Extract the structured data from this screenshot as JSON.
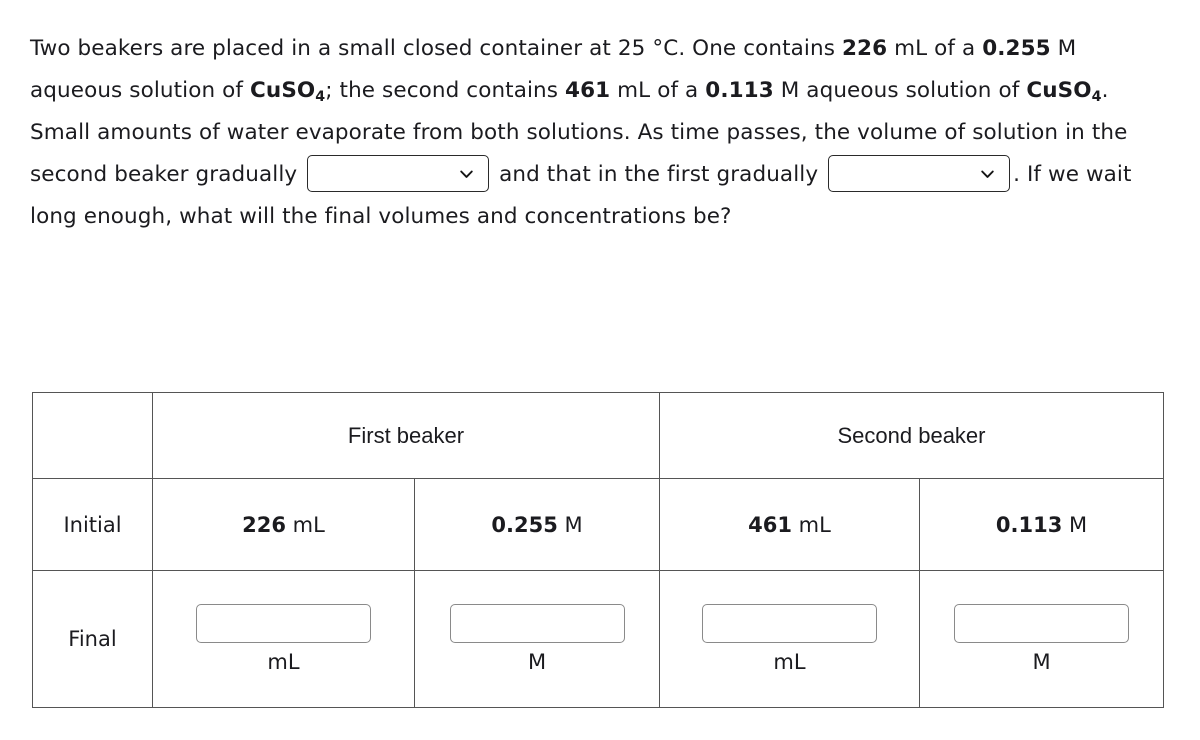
{
  "question": {
    "seg1": "Two beakers are placed in a small closed container at 25 °C. One contains ",
    "vol1": "226",
    "seg2": " mL of a ",
    "conc1": "0.255",
    "seg3": " M aqueous solution of ",
    "formula1_main": "CuSO",
    "formula1_sub": "4",
    "seg4": "; the second contains ",
    "vol2": "461",
    "seg5": " mL of a ",
    "conc2": "0.113",
    "seg6": " M aqueous solution of ",
    "formula2_main": "CuSO",
    "formula2_sub": "4",
    "seg7": ". Small amounts of water evaporate from both solutions. As time passes, the volume of solution in the second beaker gradually ",
    "seg8": " and that in the first gradually ",
    "seg9": ". If we wait long enough, what will the final volumes and concentrations be?"
  },
  "dropdowns": [
    {
      "name": "second-beaker-trend-select",
      "value": "",
      "icon": "chevron-down-icon"
    },
    {
      "name": "first-beaker-trend-select",
      "value": "",
      "icon": "chevron-down-icon"
    }
  ],
  "table": {
    "header": {
      "blank": "",
      "first_beaker": "First beaker",
      "second_beaker": "Second beaker"
    },
    "rows": [
      {
        "label": "Initial",
        "cells": [
          {
            "num": "226",
            "unit": " mL"
          },
          {
            "num": "0.255",
            "unit": " M"
          },
          {
            "num": "461",
            "unit": " mL"
          },
          {
            "num": "0.113",
            "unit": " M"
          }
        ]
      },
      {
        "label": "Final",
        "inputs": [
          {
            "value": "",
            "unit": "mL"
          },
          {
            "value": "",
            "unit": "M"
          },
          {
            "value": "",
            "unit": "mL"
          },
          {
            "value": "",
            "unit": "M"
          }
        ]
      }
    ]
  },
  "colors": {
    "text": "#1b1b1f",
    "table_border": "#555555",
    "input_border": "#8a8a8a",
    "select_border": "#2a2a2a",
    "background": "#ffffff"
  }
}
